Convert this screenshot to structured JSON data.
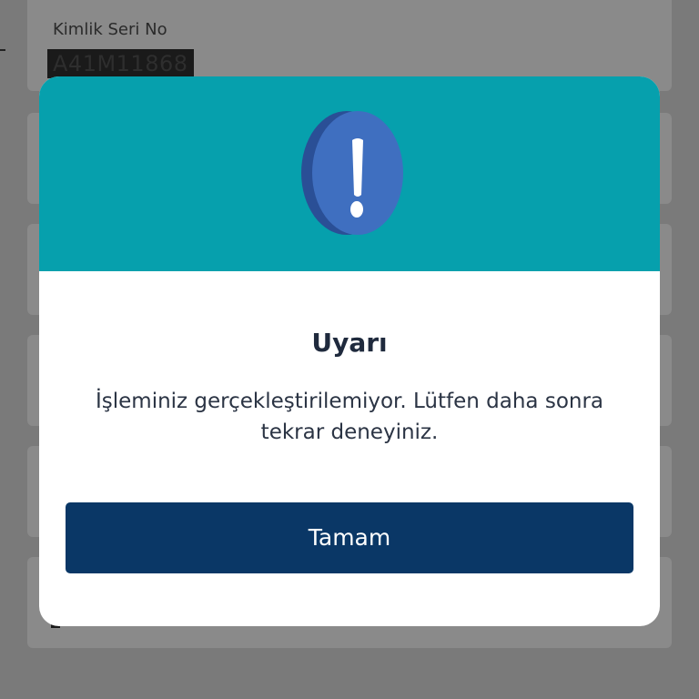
{
  "background_form": {
    "field_label": "Kimlik Seri No",
    "field_value": "A41M11868"
  },
  "dialog": {
    "icon": "exclamation-icon",
    "title": "Uyarı",
    "message": "İşleminiz gerçekleştirilemiyor. Lütfen daha sonra tekrar deneyiniz.",
    "ok_label": "Tamam"
  },
  "colors": {
    "header_teal": "#06a0ad",
    "button_navy": "#0a3766",
    "icon_blue": "#3f6fc0",
    "overlay_gray": "#7a7a7a"
  }
}
